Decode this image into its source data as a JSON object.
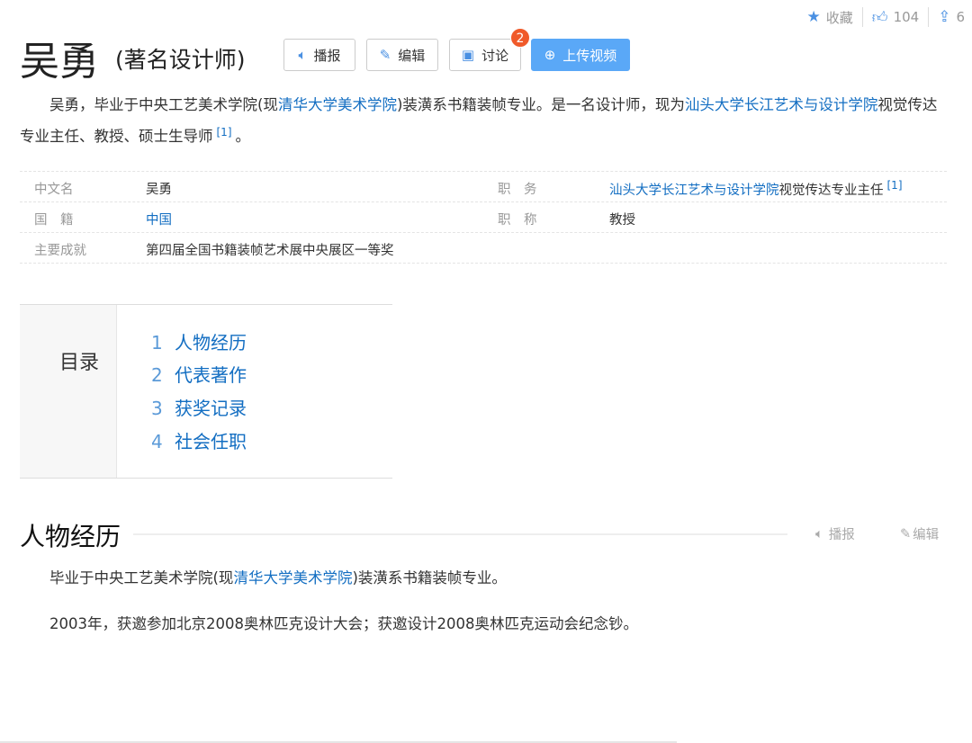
{
  "topbar": {
    "favorite_label": "收藏",
    "like_count": "104",
    "share_count": "6"
  },
  "header": {
    "title": "吴勇",
    "subtitle": "(著名设计师)",
    "buttons": {
      "broadcast": "播报",
      "edit": "编辑",
      "discuss": "讨论",
      "discuss_badge": "2",
      "upload": "上传视频"
    }
  },
  "summary": {
    "p1": "吴勇，毕业于中央工艺美术学院(现",
    "link1": "清华大学美术学院",
    "p2": ")装潢系书籍装帧专业。是一名设计师，现为",
    "link2": "汕头大学长江艺术与设计学院",
    "p3": "视觉传达专业主任、教授、硕士生导师",
    "ref": "[1]",
    "p4": "。"
  },
  "info": {
    "name_label": "中文名",
    "name_value": "吴勇",
    "position_label": "职　务",
    "position_link": "汕头大学长江艺术与设计学院",
    "position_text": "视觉传达专业主任",
    "position_ref": "[1]",
    "nationality_label": "国　籍",
    "nationality_value": "中国",
    "title_label": "职　称",
    "title_value": "教授",
    "achievement_label": "主要成就",
    "achievement_value": "第四届全国书籍装帧艺术展中央展区一等奖"
  },
  "toc": {
    "title": "目录",
    "items": [
      {
        "num": "1",
        "label": "人物经历"
      },
      {
        "num": "2",
        "label": "代表著作"
      },
      {
        "num": "3",
        "label": "获奖记录"
      },
      {
        "num": "4",
        "label": "社会任职"
      }
    ]
  },
  "section": {
    "title": "人物经历",
    "broadcast": "播报",
    "edit": "编辑",
    "p1a": "毕业于中央工艺美术学院(现",
    "p1link": "清华大学美术学院",
    "p1b": ")装潢系书籍装帧专业。",
    "p2": "2003年，获邀参加北京2008奥林匹克设计大会；获邀设计2008奥林匹克运动会纪念钞。"
  }
}
